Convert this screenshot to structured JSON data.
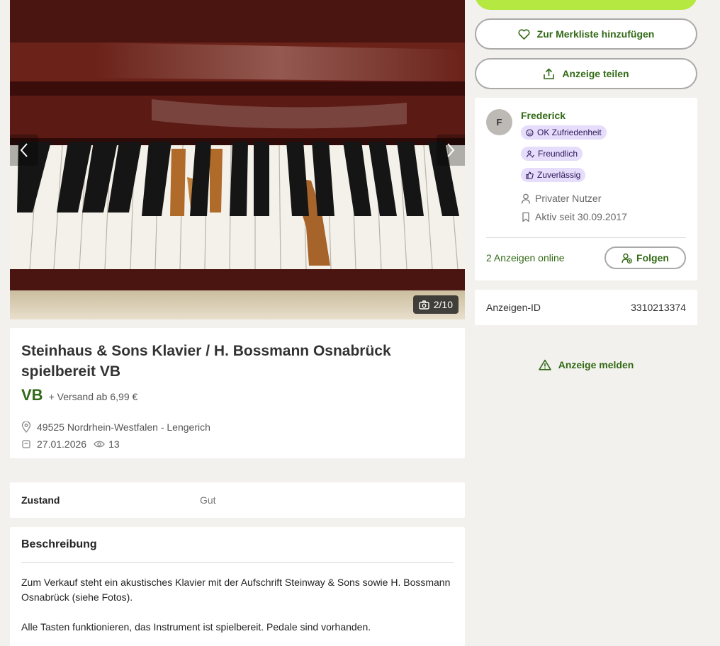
{
  "gallery": {
    "counter": "2/10",
    "prev_icon": "chevron-left-icon",
    "next_icon": "chevron-right-icon",
    "camera_icon": "camera-icon"
  },
  "listing": {
    "title": "Steinhaus & Sons Klavier / H. Bossmann Osnabrück spielbereit VB",
    "price": "VB",
    "shipping": "+ Versand ab 6,99 €",
    "location": "49525 Nordrhein-Westfalen - Lengerich",
    "date": "27.01.2026",
    "views": "13"
  },
  "details": {
    "key": "Zustand",
    "value": "Gut"
  },
  "description": {
    "title": "Beschreibung",
    "paragraphs": [
      "Zum Verkauf steht ein akustisches Klavier mit der Aufschrift Steinway & Sons sowie H. Bossmann Osnabrück (siehe Fotos).",
      "Alle Tasten funktionieren, das Instrument ist spielbereit. Pedale sind vorhanden."
    ]
  },
  "actions": {
    "watchlist": "Zur Merkliste hinzufügen",
    "share": "Anzeige teilen",
    "report": "Anzeige melden"
  },
  "seller": {
    "initial": "F",
    "name": "Frederick",
    "badges": [
      "OK Zufriedenheit",
      "Freundlich",
      "Zuverlässig"
    ],
    "type": "Privater Nutzer",
    "since": "Aktiv seit 30.09.2017",
    "ads_online": "2 Anzeigen online",
    "follow": "Folgen"
  },
  "ad_id": {
    "label": "Anzeigen-ID",
    "value": "3310213374"
  },
  "colors": {
    "accent_green": "#326916",
    "cta_lime": "#b5e941",
    "badge_purple": "#e6dcfb",
    "background": "#f2f1ed"
  }
}
